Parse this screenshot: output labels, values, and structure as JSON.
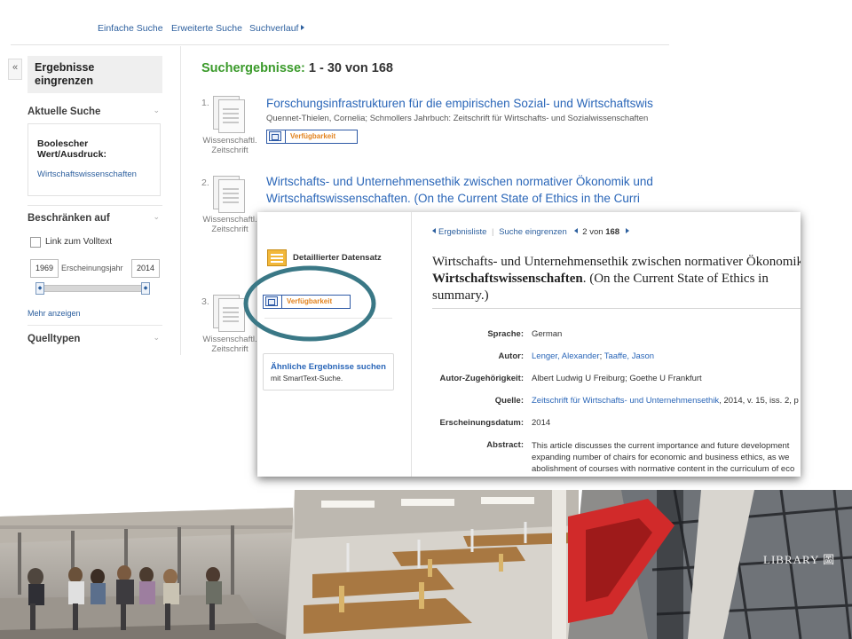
{
  "top_nav": {
    "simple_search": "Einfache Suche",
    "advanced_search": "Erweiterte Suche",
    "history": "Suchverlauf"
  },
  "sidebar": {
    "collapse_glyph": "«",
    "refine_title_1": "Ergebnisse",
    "refine_title_2": "eingrenzen",
    "current_search": "Aktuelle Suche",
    "bool_label_1": "Boolescher",
    "bool_label_2": "Wert/Ausdruck:",
    "bool_value": "Wirtschaftswissenschaften",
    "limit_to": "Beschränken auf",
    "fulltext_link": "Link zum Volltext",
    "year_from": "1969",
    "year_label": "Erscheinungsjahr",
    "year_to": "2014",
    "more": "Mehr anzeigen",
    "source_types": "Quelltypen"
  },
  "results": {
    "heading": "Suchergebnisse:",
    "range": "1 - 30 von 168",
    "items": [
      {
        "num": "1.",
        "type_1": "Wissenschaftl.",
        "type_2": "Zeitschrift",
        "title_1": "Forschungsinfrastrukturen für die empirischen Sozial- und Wirtschaftswis",
        "meta": "Quennet-Thielen, Cornelia; Schmollers Jahrbuch: Zeitschrift für Wirtschafts- und Sozialwissenschaften",
        "availability": "Verfügbarkeit"
      },
      {
        "num": "2.",
        "type_1": "Wissenschaftl.",
        "type_2": "Zeitschrift",
        "title_1": "Wirtschafts- und Unternehmensethik zwischen normativer Ökonomik und",
        "title_2": "Wirtschaftswissenschaften. (On the Current State of Ethics in the Curri"
      },
      {
        "num": "3.",
        "type_1": "Wissenschaftl.",
        "type_2": "Zeitschrift"
      }
    ]
  },
  "detail": {
    "nav_back": "Ergebnisliste",
    "nav_refine": "Suche eingrenzen",
    "nav_pos": "2",
    "nav_of": "von",
    "nav_total": "168",
    "detailed_record": "Detaillierter Datensatz",
    "availability": "Verfügbarkeit",
    "similar_title": "Ähnliche Ergebnisse suchen",
    "similar_sub": "mit SmartText-Suche.",
    "title_line1": "Wirtschafts- und Unternehmensethik zwischen normativer Ökonomik",
    "title_line2_bold": "Wirtschaftswissenschaften",
    "title_line2_rest": ". (On the Current State of Ethics in",
    "title_line3": "summary.)",
    "fields": {
      "language_label": "Sprache:",
      "language_value": "German",
      "author_label": "Autor:",
      "author_1": "Lenger, Alexander",
      "author_2": "Taaffe, Jason",
      "affil_label": "Autor-Zugehörigkeit:",
      "affil_value": "Albert Ludwig U Freiburg; Goethe U Frankfurt",
      "source_label": "Quelle:",
      "source_link": "Zeitschrift für Wirtschafts- und Unternehmensethik",
      "source_rest": ", 2014, v. 15, iss. 2, p",
      "date_label": "Erscheinungsdatum:",
      "date_value": "2014",
      "abstract_label": "Abstract:",
      "abstract_1": "This article discusses the current importance and future development",
      "abstract_2": "expanding number of chairs for economic and business ethics, as we",
      "abstract_3": "abolishment of courses with normative content in the curriculum of eco"
    }
  },
  "colors": {
    "link": "#2a66b8",
    "result_heading": "#3a9a2a",
    "availability_text": "#e2831f",
    "highlight_circle": "#3a7886"
  },
  "banner": {
    "photo_4_sign": "LIBRARY 圖"
  }
}
